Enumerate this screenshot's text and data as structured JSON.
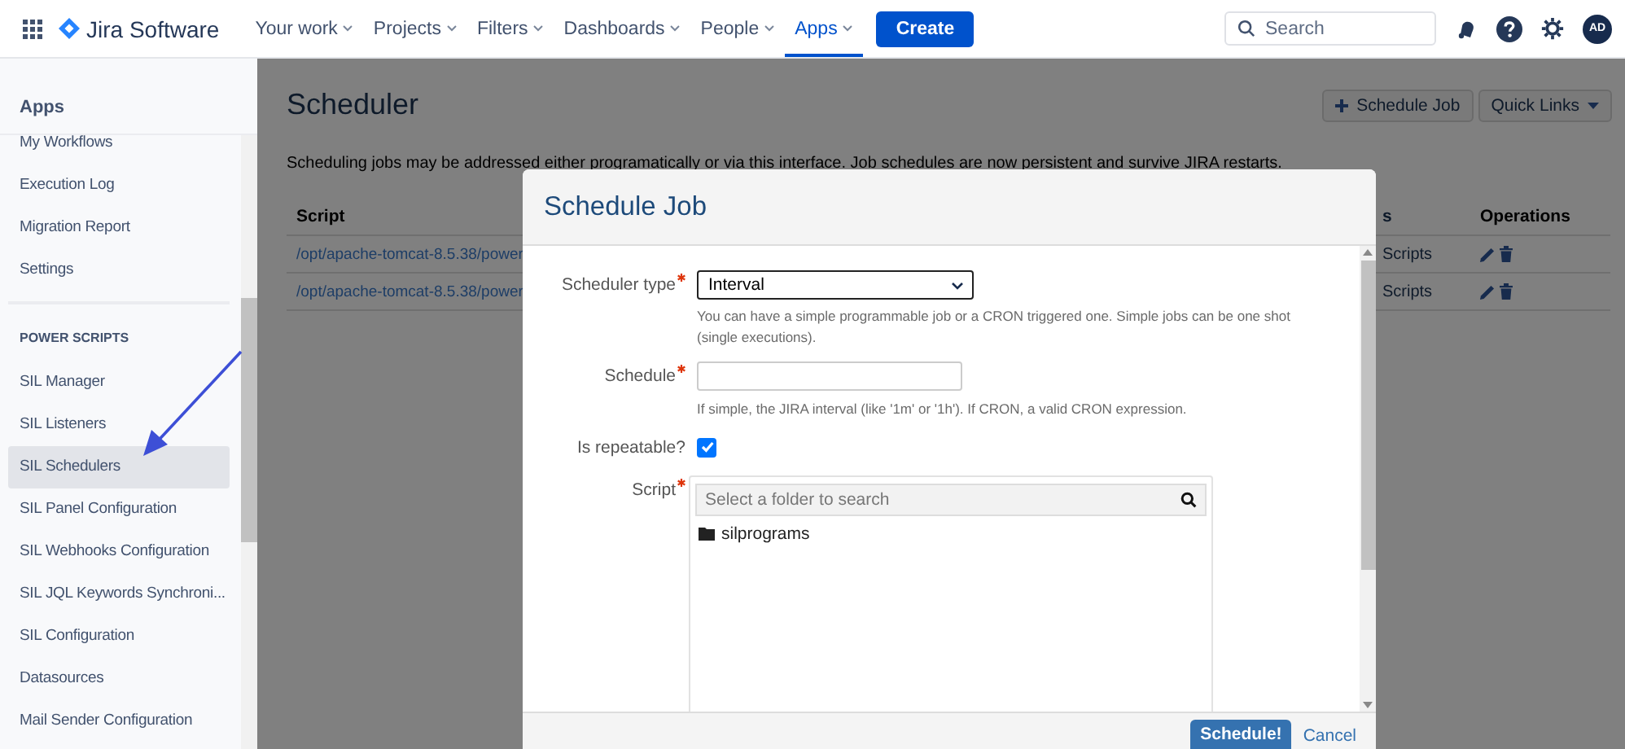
{
  "topbar": {
    "product": "Jira Software",
    "nav": [
      {
        "label": "Your work",
        "selected": false
      },
      {
        "label": "Projects",
        "selected": false
      },
      {
        "label": "Filters",
        "selected": false
      },
      {
        "label": "Dashboards",
        "selected": false
      },
      {
        "label": "People",
        "selected": false
      },
      {
        "label": "Apps",
        "selected": true
      }
    ],
    "create": "Create",
    "search": {
      "placeholder": "Search"
    },
    "avatar": "AD"
  },
  "sidebar": {
    "title": "Apps",
    "items": [
      {
        "kind": "item",
        "label": "My Workflows",
        "selected": false
      },
      {
        "kind": "item",
        "label": "Execution Log",
        "selected": false
      },
      {
        "kind": "item",
        "label": "Migration Report",
        "selected": false
      },
      {
        "kind": "item",
        "label": "Settings",
        "selected": false
      },
      {
        "kind": "heading",
        "label": "POWER SCRIPTS"
      },
      {
        "kind": "item",
        "label": "SIL Manager",
        "selected": false
      },
      {
        "kind": "item",
        "label": "SIL Listeners",
        "selected": false
      },
      {
        "kind": "item",
        "label": "SIL Schedulers",
        "selected": true
      },
      {
        "kind": "item",
        "label": "SIL Panel Configuration",
        "selected": false
      },
      {
        "kind": "item",
        "label": "SIL Webhooks Configuration",
        "selected": false
      },
      {
        "kind": "item",
        "label": "SIL JQL Keywords Synchroni...",
        "selected": false
      },
      {
        "kind": "item",
        "label": "SIL Configuration",
        "selected": false
      },
      {
        "kind": "item",
        "label": "Datasources",
        "selected": false
      },
      {
        "kind": "item",
        "label": "Mail Sender Configuration",
        "selected": false
      }
    ]
  },
  "page": {
    "title": "Scheduler",
    "actions": [
      {
        "kind": "add",
        "label": "Schedule Job"
      },
      {
        "kind": "menu",
        "label": "Quick Links"
      }
    ],
    "description": "Scheduling jobs may be addressed either programatically or via this interface. Job schedules are now persistent and survive JIRA restarts.",
    "table": {
      "columns": [
        "Script",
        "s",
        "Operations"
      ],
      "rows": [
        {
          "cells": [
            "/opt/apache-tomcat-8.5.38/power",
            "Scripts"
          ]
        },
        {
          "cells": [
            "/opt/apache-tomcat-8.5.38/power",
            "Scripts"
          ]
        }
      ]
    }
  },
  "dialog": {
    "title": "Schedule Job",
    "fields": [
      {
        "kind": "select",
        "label": "Scheduler type",
        "required": true,
        "value": "Interval",
        "hint": "You can have a simple programmable job or a CRON triggered one. Simple jobs can be one shot (single executions)."
      },
      {
        "kind": "text",
        "label": "Schedule",
        "required": true,
        "hint": "If simple, the JIRA interval (like '1m' or '1h'). If CRON, a valid CRON expression."
      },
      {
        "kind": "checkbox",
        "label": "Is repeatable?",
        "required": false,
        "checked": true
      },
      {
        "kind": "tree",
        "label": "Script",
        "required": true,
        "placeholder": "Select a folder to search",
        "items": [
          "silprograms"
        ]
      }
    ],
    "primary": "Schedule!",
    "cancel": "Cancel"
  }
}
